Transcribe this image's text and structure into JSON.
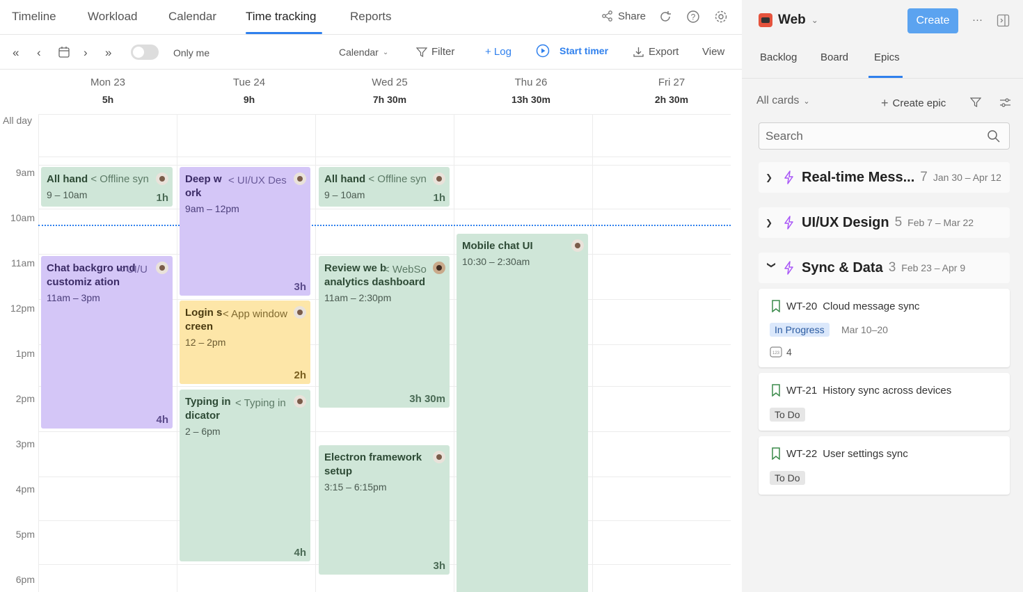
{
  "topnav": {
    "tabs": [
      "Timeline",
      "Workload",
      "Calendar",
      "Time tracking",
      "Reports"
    ],
    "active_tab": "Time tracking",
    "share_label": "Share"
  },
  "toolbar": {
    "only_me_label": "Only me",
    "calendar_label": "Calendar",
    "filter_label": "Filter",
    "log_label": "+ Log",
    "start_timer_label": "Start timer",
    "export_label": "Export",
    "view_label": "View"
  },
  "days": [
    {
      "name": "Mon  23",
      "total": "5h"
    },
    {
      "name": "Tue  24",
      "total": "9h"
    },
    {
      "name": "Wed  25",
      "total": "7h 30m"
    },
    {
      "name": "Thu  26",
      "total": "13h 30m"
    },
    {
      "name": "Fri  27",
      "total": "2h 30m"
    }
  ],
  "all_day_label": "All day",
  "hours": [
    "9am",
    "10am",
    "11am",
    "12pm",
    "1pm",
    "2pm",
    "3pm",
    "4pm",
    "5pm",
    "6pm"
  ],
  "events": {
    "mon_allhand": {
      "title": "All hand",
      "parent": "< Offline syn",
      "time": "9 – 10am",
      "duration": "1h"
    },
    "mon_chat": {
      "title": "Chat backgro und customiz ation",
      "parent": "< UI/U",
      "time": "11am – 3pm",
      "duration": "4h"
    },
    "tue_deep": {
      "title": "Deep w ork",
      "parent": "< UI/UX Des",
      "time": "9am – 12pm",
      "duration": "3h"
    },
    "tue_login": {
      "title": "Login s creen",
      "parent": "< App window",
      "time": "12 – 2pm",
      "duration": "2h"
    },
    "tue_typing": {
      "title": "Typing in dicator",
      "parent": "< Typing in",
      "time": "2 – 6pm",
      "duration": "4h"
    },
    "wed_allhand": {
      "title": "All hand",
      "parent": "< Offline syn",
      "time": "9 – 10am",
      "duration": "1h"
    },
    "wed_review": {
      "title": "Review we b analytics dashboard",
      "parent": "< WebSo",
      "time": "11am – 2:30pm",
      "duration": "3h 30m"
    },
    "wed_electron": {
      "title": "Electron framework setup",
      "parent": "",
      "time": "3:15 – 6:15pm",
      "duration": "3h"
    },
    "thu_mobile": {
      "title": "Mobile chat UI",
      "parent": "",
      "time": "10:30 – 2:30am",
      "duration": ""
    }
  },
  "side": {
    "project_name": "Web",
    "create_label": "Create",
    "more_label": "···",
    "tabs": [
      "Backlog",
      "Board",
      "Epics"
    ],
    "active_tab": "Epics",
    "all_cards_label": "All cards",
    "create_epic_label": "Create epic",
    "search_placeholder": "Search",
    "epics": [
      {
        "name": "Real-time Mess...",
        "count": "7",
        "dates": "Jan 30 – Apr 12"
      },
      {
        "name": "UI/UX Design",
        "count": "5",
        "dates": "Feb 7 – Mar 22"
      },
      {
        "name": "Sync & Data",
        "count": "3",
        "dates": "Feb 23 – Apr 9"
      }
    ],
    "cards": [
      {
        "key": "WT-20",
        "title": "Cloud message sync",
        "status": "In Progress",
        "dates": "Mar 10–20",
        "points": "4"
      },
      {
        "key": "WT-21",
        "title": "History sync across devices",
        "status": "To Do"
      },
      {
        "key": "WT-22",
        "title": "User settings sync",
        "status": "To Do"
      }
    ]
  },
  "colors": {
    "accent": "#2f80ed",
    "event_green": "#cfe6d8",
    "event_purple": "#d4c6f7",
    "event_yellow": "#fde6a8",
    "bolt": "#a855f7",
    "bookmark": "#3a8a4a"
  }
}
